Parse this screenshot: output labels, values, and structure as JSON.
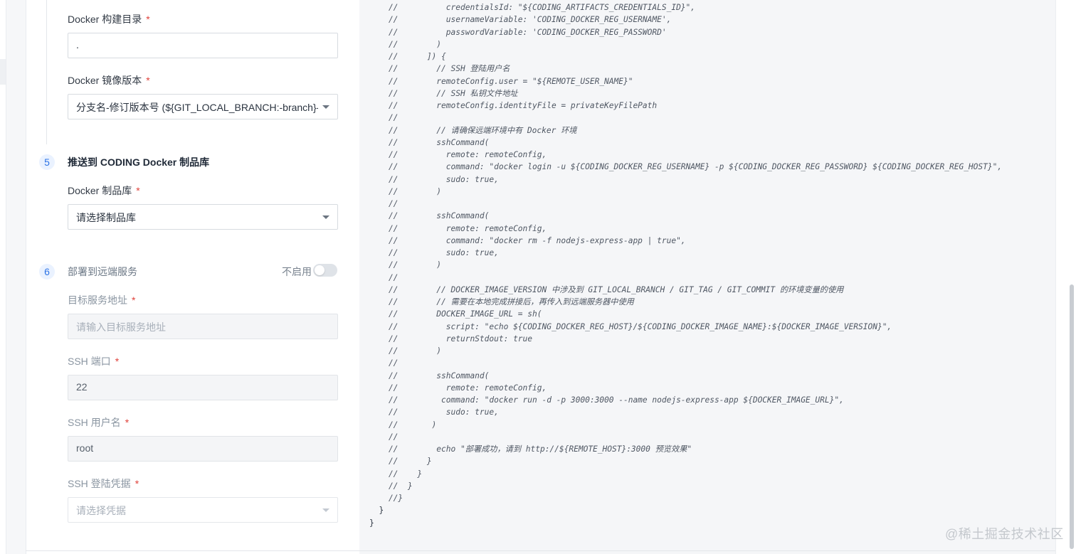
{
  "form": {
    "build_dir": {
      "label": "Docker 构建目录",
      "required": "*",
      "value": "."
    },
    "image_version": {
      "label": "Docker 镜像版本",
      "required": "*",
      "value": "分支名-修订版本号 (${GIT_LOCAL_BRANCH:-branch}-$"
    },
    "step5": {
      "number": "5",
      "title": "推送到 CODING Docker 制品库"
    },
    "registry": {
      "label": "Docker 制品库",
      "required": "*",
      "value": "请选择制品库"
    },
    "step6": {
      "number": "6",
      "title": "部署到远端服务",
      "toggle_label": "不启用",
      "enabled": false
    },
    "target_host": {
      "label": "目标服务地址",
      "required": "*",
      "placeholder": "请输入目标服务地址"
    },
    "ssh_port": {
      "label": "SSH 端口",
      "required": "*",
      "value": "22"
    },
    "ssh_user": {
      "label": "SSH 用户名",
      "required": "*",
      "value": "root"
    },
    "ssh_credential": {
      "label": "SSH 登陆凭据",
      "required": "*",
      "placeholder": "请选择凭据"
    }
  },
  "code_lines": [
    {
      "text": "    //          credentialsId: \"${CODING_ARTIFACTS_CREDENTIALS_ID}\",",
      "plain": false
    },
    {
      "text": "    //          usernameVariable: 'CODING_DOCKER_REG_USERNAME',",
      "plain": false
    },
    {
      "text": "    //          passwordVariable: 'CODING_DOCKER_REG_PASSWORD'",
      "plain": false
    },
    {
      "text": "    //        )",
      "plain": false
    },
    {
      "text": "    //      ]) {",
      "plain": false
    },
    {
      "text": "    //        // SSH 登陆用户名",
      "plain": false
    },
    {
      "text": "    //        remoteConfig.user = \"${REMOTE_USER_NAME}\"",
      "plain": false
    },
    {
      "text": "    //        // SSH 私钥文件地址",
      "plain": false
    },
    {
      "text": "    //        remoteConfig.identityFile = privateKeyFilePath",
      "plain": false
    },
    {
      "text": "    //",
      "plain": false
    },
    {
      "text": "    //        // 请确保远端环境中有 Docker 环境",
      "plain": false
    },
    {
      "text": "    //        sshCommand(",
      "plain": false
    },
    {
      "text": "    //          remote: remoteConfig,",
      "plain": false
    },
    {
      "text": "    //          command: \"docker login -u ${CODING_DOCKER_REG_USERNAME} -p ${CODING_DOCKER_REG_PASSWORD} ${CODING_DOCKER_REG_HOST}\",",
      "plain": false
    },
    {
      "text": "    //          sudo: true,",
      "plain": false
    },
    {
      "text": "    //        )",
      "plain": false
    },
    {
      "text": "    //",
      "plain": false
    },
    {
      "text": "    //        sshCommand(",
      "plain": false
    },
    {
      "text": "    //          remote: remoteConfig,",
      "plain": false
    },
    {
      "text": "    //          command: \"docker rm -f nodejs-express-app | true\",",
      "plain": false
    },
    {
      "text": "    //          sudo: true,",
      "plain": false
    },
    {
      "text": "    //        )",
      "plain": false
    },
    {
      "text": "    //",
      "plain": false
    },
    {
      "text": "    //        // DOCKER_IMAGE_VERSION 中涉及到 GIT_LOCAL_BRANCH / GIT_TAG / GIT_COMMIT 的环境变量的使用",
      "plain": false
    },
    {
      "text": "    //        // 需要在本地完成拼接后，再传入到远端服务器中使用",
      "plain": false
    },
    {
      "text": "    //        DOCKER_IMAGE_URL = sh(",
      "plain": false
    },
    {
      "text": "    //          script: \"echo ${CODING_DOCKER_REG_HOST}/${CODING_DOCKER_IMAGE_NAME}:${DOCKER_IMAGE_VERSION}\",",
      "plain": false
    },
    {
      "text": "    //          returnStdout: true",
      "plain": false
    },
    {
      "text": "    //        )",
      "plain": false
    },
    {
      "text": "    //",
      "plain": false
    },
    {
      "text": "    //        sshCommand(",
      "plain": false
    },
    {
      "text": "    //          remote: remoteConfig,",
      "plain": false
    },
    {
      "text": "    //         command: \"docker run -d -p 3000:3000 --name nodejs-express-app ${DOCKER_IMAGE_URL}\",",
      "plain": false
    },
    {
      "text": "    //          sudo: true,",
      "plain": false
    },
    {
      "text": "    //       )",
      "plain": false
    },
    {
      "text": "    //",
      "plain": false
    },
    {
      "text": "    //        echo \"部署成功，请到 http://${REMOTE_HOST}:3000 预览效果\"",
      "plain": false
    },
    {
      "text": "    //      }",
      "plain": false
    },
    {
      "text": "    //    }",
      "plain": false
    },
    {
      "text": "    //  }",
      "plain": false
    },
    {
      "text": "    //}",
      "plain": false
    },
    {
      "text": "  }",
      "plain": true
    },
    {
      "text": "}",
      "plain": true
    }
  ],
  "watermark": "@稀土掘金技术社区",
  "colors": {
    "accent": "#2e74e5",
    "required": "#e0423b",
    "code_bg": "#f5f6f8"
  }
}
